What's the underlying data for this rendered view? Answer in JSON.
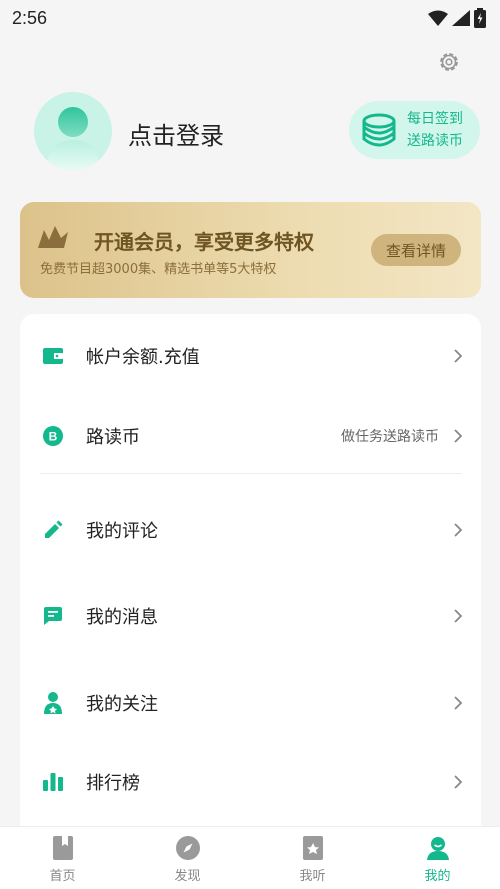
{
  "status_bar": {
    "time": "2:56"
  },
  "profile": {
    "login_text": "点击登录"
  },
  "checkin": {
    "line1": "每日签到",
    "line2": "送路读币"
  },
  "vip": {
    "title": "开通会员，享受更多特权",
    "subtitle": "免费节目超3000集、精选书单等5大特权",
    "button": "查看详情"
  },
  "menu": {
    "items": [
      {
        "label": "帐户余额.充值",
        "icon": "wallet-icon",
        "hint": ""
      },
      {
        "label": "路读币",
        "icon": "coin-icon",
        "hint": "做任务送路读币"
      },
      {
        "label": "我的评论",
        "icon": "pencil-icon",
        "hint": ""
      },
      {
        "label": "我的消息",
        "icon": "message-icon",
        "hint": ""
      },
      {
        "label": "我的关注",
        "icon": "follow-icon",
        "hint": ""
      },
      {
        "label": "排行榜",
        "icon": "ranking-icon",
        "hint": ""
      }
    ]
  },
  "tabs": [
    {
      "label": "首页",
      "icon": "book-icon"
    },
    {
      "label": "发现",
      "icon": "compass-icon"
    },
    {
      "label": "我听",
      "icon": "bookmark-icon"
    },
    {
      "label": "我的",
      "icon": "user-icon"
    }
  ],
  "colors": {
    "accent": "#13b88c",
    "gold": "#dcc28a",
    "background": "#f5f5f5"
  }
}
